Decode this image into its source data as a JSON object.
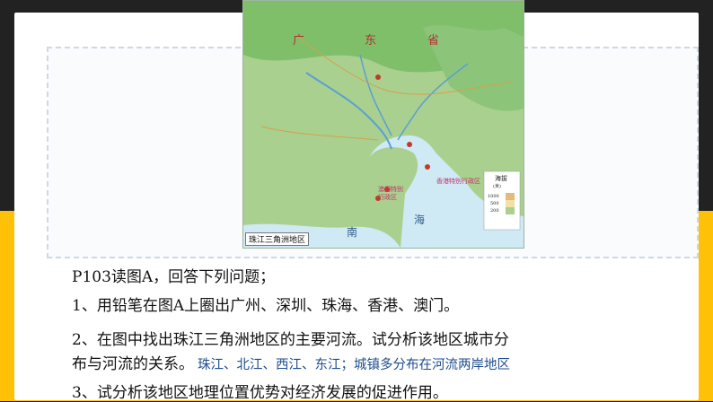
{
  "map": {
    "caption": "珠江三角洲地区",
    "labels": {
      "guang": "广",
      "dong": "东",
      "sheng": "省",
      "nan": "南",
      "hai": "海",
      "legend_title": "海拔",
      "legend_unit": "(米)",
      "legend_1000": "1000",
      "legend_500": "500",
      "legend_200": "200",
      "hk_zone": "香港特别行政区",
      "macau_zone_1": "澳门特别",
      "macau_zone_2": "行政区"
    }
  },
  "content": {
    "q_title": "P103读图A，回答下列问题；",
    "q1": "1、用铅笔在图A上圈出广州、深圳、珠海、香港、澳门。",
    "q2_line1": "2、在图中找出珠江三角洲地区的主要河流。试分析该地区城市分",
    "q2_line2_prefix": "布与河流的关系。",
    "q2_answer": "珠江、北江、西江、东江；城镇多分布在河流两岸地区",
    "q3": "3、试分析该地区地理位置优势对经济发展的促进作用。"
  }
}
